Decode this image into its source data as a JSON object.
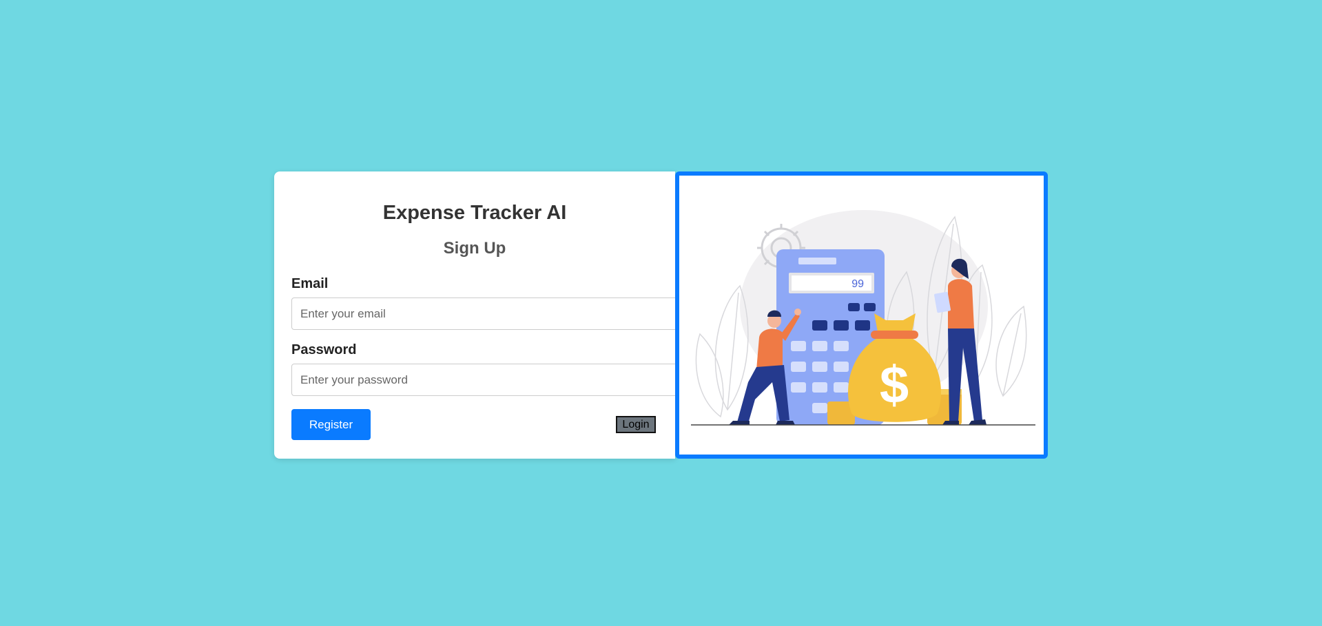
{
  "header": {
    "app_title": "Expense Tracker AI",
    "page_title": "Sign Up"
  },
  "form": {
    "email_label": "Email",
    "email_placeholder": "Enter your email",
    "email_value": "",
    "password_label": "Password",
    "password_placeholder": "Enter your password",
    "password_value": "",
    "register_label": "Register",
    "login_label": "Login"
  },
  "illustration": {
    "calculator_display": "99",
    "icons": [
      "calculator-icon",
      "money-bag-icon",
      "dollar-sign-icon",
      "gear-icon",
      "leaf-icon"
    ]
  },
  "colors": {
    "background": "#6fd8e2",
    "accent": "#0a7bff",
    "card": "#ffffff",
    "login_button": "#6c757d"
  }
}
